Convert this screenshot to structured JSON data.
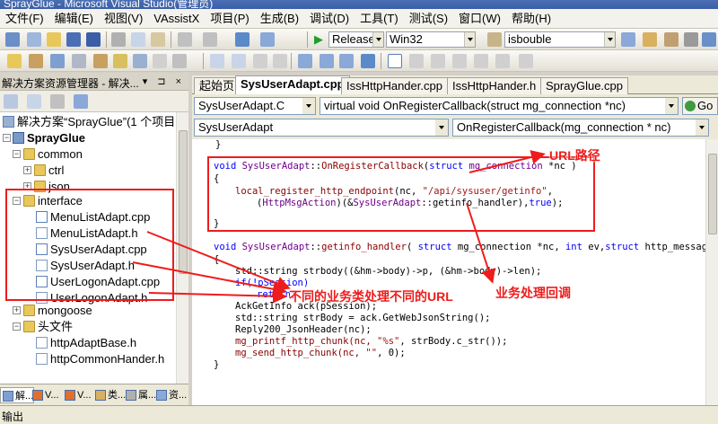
{
  "window": {
    "title": "SprayGlue - Microsoft Visual Studio(管理员)"
  },
  "menu": [
    "文件(F)",
    "编辑(E)",
    "视图(V)",
    "VAssistX",
    "项目(P)",
    "生成(B)",
    "调试(D)",
    "工具(T)",
    "测试(S)",
    "窗口(W)",
    "帮助(H)"
  ],
  "toolbar": {
    "config": "Release",
    "platform": "Win32",
    "find_value": "isbouble"
  },
  "solution_explorer": {
    "title": "解决方案资源管理器 - 解决...",
    "header_buttons": "▾ ⊐ ×",
    "items": [
      {
        "label": "解决方案“SprayGlue”(1 个项目",
        "kind": "solution"
      },
      {
        "label": "SprayGlue",
        "kind": "project"
      },
      {
        "label": "common",
        "kind": "folder"
      },
      {
        "label": "ctrl",
        "kind": "folder"
      },
      {
        "label": "json",
        "kind": "folder"
      },
      {
        "label": "interface",
        "kind": "folder"
      },
      {
        "label": "MenuListAdapt.cpp",
        "kind": "cpp"
      },
      {
        "label": "MenuListAdapt.h",
        "kind": "h"
      },
      {
        "label": "SysUserAdapt.cpp",
        "kind": "cpp"
      },
      {
        "label": "SysUserAdapt.h",
        "kind": "h"
      },
      {
        "label": "UserLogonAdapt.cpp",
        "kind": "cpp"
      },
      {
        "label": "UserLogonAdapt.h",
        "kind": "h"
      },
      {
        "label": "mongoose",
        "kind": "folder"
      },
      {
        "label": "头文件",
        "kind": "folder"
      },
      {
        "label": "httpAdaptBase.h",
        "kind": "h"
      },
      {
        "label": "httpCommonHander.h",
        "kind": "h"
      }
    ],
    "bottom_tabs": [
      "解...",
      "V...",
      "V...",
      "类...",
      "属...",
      "资..."
    ]
  },
  "doc_tabs": [
    "起始页",
    "SysUserAdapt.cpp",
    "IssHttpHander.cpp",
    "IssHttpHander.h",
    "SprayGlue.cpp"
  ],
  "navbar": {
    "class_combo": "SysUserAdapt.C",
    "func_combo": "virtual void OnRegisterCallback(struct mg_connection *nc)",
    "go": "Go",
    "scope_combo": "SysUserAdapt",
    "member_combo": "OnRegisterCallback(mg_connection * nc)"
  },
  "code": {
    "l1": "}",
    "l2_void": "void ",
    "l2_cls": "SysUserAdapt",
    "l2_sep": "::",
    "l2_fn": "OnRegisterCallback",
    "l2_args_open": "(",
    "l2_struct": "struct",
    "l2_type": " mg_connection",
    "l2_rest": " *nc )",
    "l3": "{",
    "l4_fn": "local_register_http_endpoint",
    "l4_a": "(nc, ",
    "l4_str": "\"/api/sysuser/getinfo\"",
    "l4_b": ",",
    "l5_a": "(",
    "l5_ty": "HttpMsgAction",
    "l5_b": ")(&",
    "l5_cls": "SysUserAdapt",
    "l5_c": "::getinfo_handler),",
    "l5_kw": "true",
    "l5_d": ");",
    "l6": "}",
    "l7_void": "void ",
    "l7_cls": "SysUserAdapt",
    "l7_sep": "::",
    "l7_fn": "getinfo_handler",
    "l7_a": "( ",
    "l7_struct": "struct",
    "l7_b": " mg_connection *nc, ",
    "l7_int": "int",
    "l7_c": " ev,",
    "l7_struct2": "struct",
    "l7_d": " http_message *",
    "l8": "{",
    "l9_a": "std::string strbody((&hm->body)->p, (&hm->body)->len);",
    "l10": "if(!pSession)",
    "l11": "return;",
    "l12": "AckGetInfo ack(pSession);",
    "l13": "std::string strBody = ack.GetWebJsonString();",
    "l14": "Reply200_JsonHeader(nc);",
    "l15_a": "mg_printf_http_chunk(nc, ",
    "l15_str": "\"%s\"",
    "l15_b": ", strBody.c_str());",
    "l16_a": "mg_send_http_chunk(nc, ",
    "l16_str": "\"\"",
    "l16_b": ", 0);",
    "l17": "}"
  },
  "annotations": {
    "url_path": "URL路径",
    "different_url": "不同的业务类处理不同的URL",
    "business_callback": "业务处理回调"
  },
  "output": {
    "label": "输出"
  },
  "colors": {
    "annotation": "#ee1c1c",
    "keyword": "#0000ff",
    "string": "#a31515",
    "type": "#6f008a"
  }
}
